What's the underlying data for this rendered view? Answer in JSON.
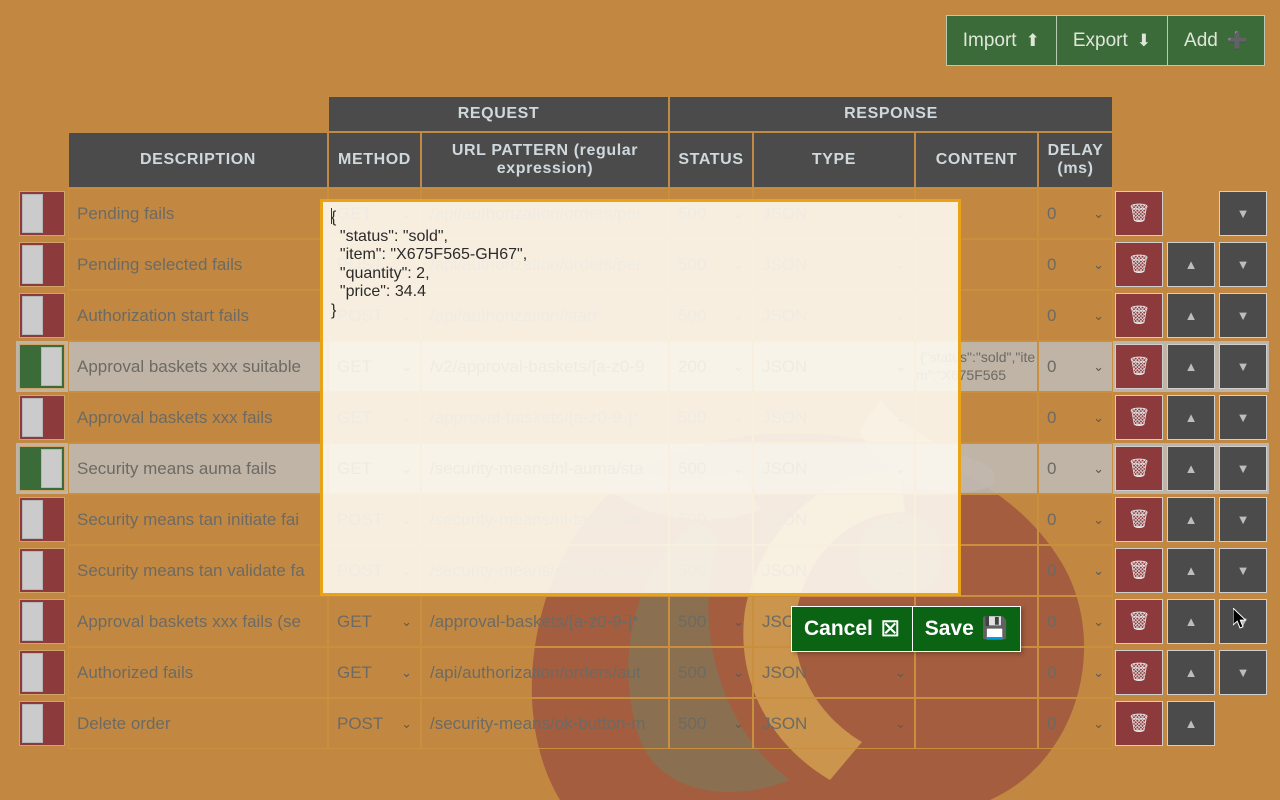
{
  "theme": {
    "page_background": "#c28841",
    "header_background": "#4b4b4b",
    "toolbar_green": "#3b6b38",
    "modal_green": "#0a6413",
    "delete_red": "#8d3a3d",
    "toggle_on_green": "#3b6b38",
    "toggle_off_red": "#8d3a3d",
    "editor_border": "#e8a317",
    "editor_background": "#fdfaf1"
  },
  "toolbar": {
    "buttons": [
      {
        "label": "Import",
        "icon": "upload-icon",
        "glyph": "⬆"
      },
      {
        "label": "Export",
        "icon": "download-icon",
        "glyph": "⬇"
      },
      {
        "label": "Add",
        "icon": "plus-icon",
        "glyph": "➕"
      }
    ]
  },
  "table": {
    "group_headers": [
      {
        "label": "REQUEST"
      },
      {
        "label": "RESPONSE"
      }
    ],
    "columns": [
      {
        "key": "description",
        "label": "DESCRIPTION"
      },
      {
        "key": "method",
        "label": "METHOD"
      },
      {
        "key": "url",
        "label": "URL PATTERN (regular expression)"
      },
      {
        "key": "status",
        "label": "STATUS"
      },
      {
        "key": "type",
        "label": "TYPE"
      },
      {
        "key": "content",
        "label": "CONTENT"
      },
      {
        "key": "delay",
        "label": "DELAY (ms)"
      }
    ],
    "row_actions": {
      "delete": {
        "icon": "trash-icon",
        "glyph": "🗑"
      },
      "move_up": {
        "icon": "chevron-up-icon",
        "glyph": "▲"
      },
      "move_down": {
        "icon": "chevron-down-icon",
        "glyph": "▼"
      }
    },
    "select_chevron": "⌄",
    "rows": [
      {
        "enabled": "Off",
        "description": "Pending fails",
        "method": "GET",
        "url": "/api/authorization/orders/per",
        "status": "500",
        "type": "JSON",
        "content": "",
        "delay": "0",
        "selected": false,
        "can_move_up": false,
        "can_move_down": true
      },
      {
        "enabled": "Off",
        "description": "Pending selected fails",
        "method": "POST",
        "url": "/api/authorization/orders/per",
        "status": "500",
        "type": "JSON",
        "content": "",
        "delay": "0",
        "selected": false,
        "can_move_up": true,
        "can_move_down": true
      },
      {
        "enabled": "Off",
        "description": "Authorization start fails",
        "method": "POST",
        "url": "/api/authorization/start",
        "status": "500",
        "type": "JSON",
        "content": "",
        "delay": "0",
        "selected": false,
        "can_move_up": true,
        "can_move_down": true
      },
      {
        "enabled": "On",
        "description": "Approval baskets xxx suitable",
        "method": "GET",
        "url": "/v2/approval-baskets/[a-z0-9",
        "status": "200",
        "type": "JSON",
        "content": "{\"status\":\"sold\",\"item\":\"X675F565",
        "delay": "0",
        "selected": true,
        "can_move_up": true,
        "can_move_down": true
      },
      {
        "enabled": "Off",
        "description": "Approval baskets xxx fails",
        "method": "GET",
        "url": "/approval-baskets/[a-z0-9-]*",
        "status": "500",
        "type": "JSON",
        "content": "",
        "delay": "0",
        "selected": false,
        "can_move_up": true,
        "can_move_down": true
      },
      {
        "enabled": "On",
        "description": "Security means auma fails",
        "method": "GET",
        "url": "/security-means/nl-auma/sta",
        "status": "500",
        "type": "JSON",
        "content": "",
        "delay": "0",
        "selected": true,
        "can_move_up": true,
        "can_move_down": true
      },
      {
        "enabled": "Off",
        "description": "Security means tan initiate fai",
        "method": "POST",
        "url": "/security-means/nl-tan/initiat",
        "status": "500",
        "type": "JSON",
        "content": "",
        "delay": "0",
        "selected": false,
        "can_move_up": true,
        "can_move_down": true
      },
      {
        "enabled": "Off",
        "description": "Security means tan validate fa",
        "method": "POST",
        "url": "/security-means/nl-tan/validat",
        "status": "500",
        "type": "JSON",
        "content": "",
        "delay": "0",
        "selected": false,
        "can_move_up": true,
        "can_move_down": true
      },
      {
        "enabled": "Off",
        "description": "Approval baskets xxx fails (se",
        "method": "GET",
        "url": "/approval-baskets/[a-z0-9-]*",
        "status": "500",
        "type": "JSON",
        "content": "",
        "delay": "0",
        "selected": false,
        "can_move_up": true,
        "can_move_down": true
      },
      {
        "enabled": "Off",
        "description": "Authorized fails",
        "method": "GET",
        "url": "/api/authorization/orders/aut",
        "status": "500",
        "type": "JSON",
        "content": "",
        "delay": "0",
        "selected": false,
        "can_move_up": true,
        "can_move_down": true
      },
      {
        "enabled": "Off",
        "description": "Delete order",
        "method": "POST",
        "url": "/security-means/ok-button-m",
        "status": "500",
        "type": "JSON",
        "content": "",
        "delay": "0",
        "selected": false,
        "can_move_up": true,
        "can_move_down": false
      }
    ]
  },
  "editor": {
    "value": "{\n  \"status\": \"sold\",\n  \"item\": \"X675F565-GH67\",\n  \"quantity\": 2,\n  \"price\": 34.4\n}",
    "buttons": [
      {
        "label": "Cancel",
        "icon": "boxed-x-icon",
        "glyph": "☒"
      },
      {
        "label": "Save",
        "icon": "floppy-disk-icon",
        "glyph": "💾"
      }
    ]
  }
}
